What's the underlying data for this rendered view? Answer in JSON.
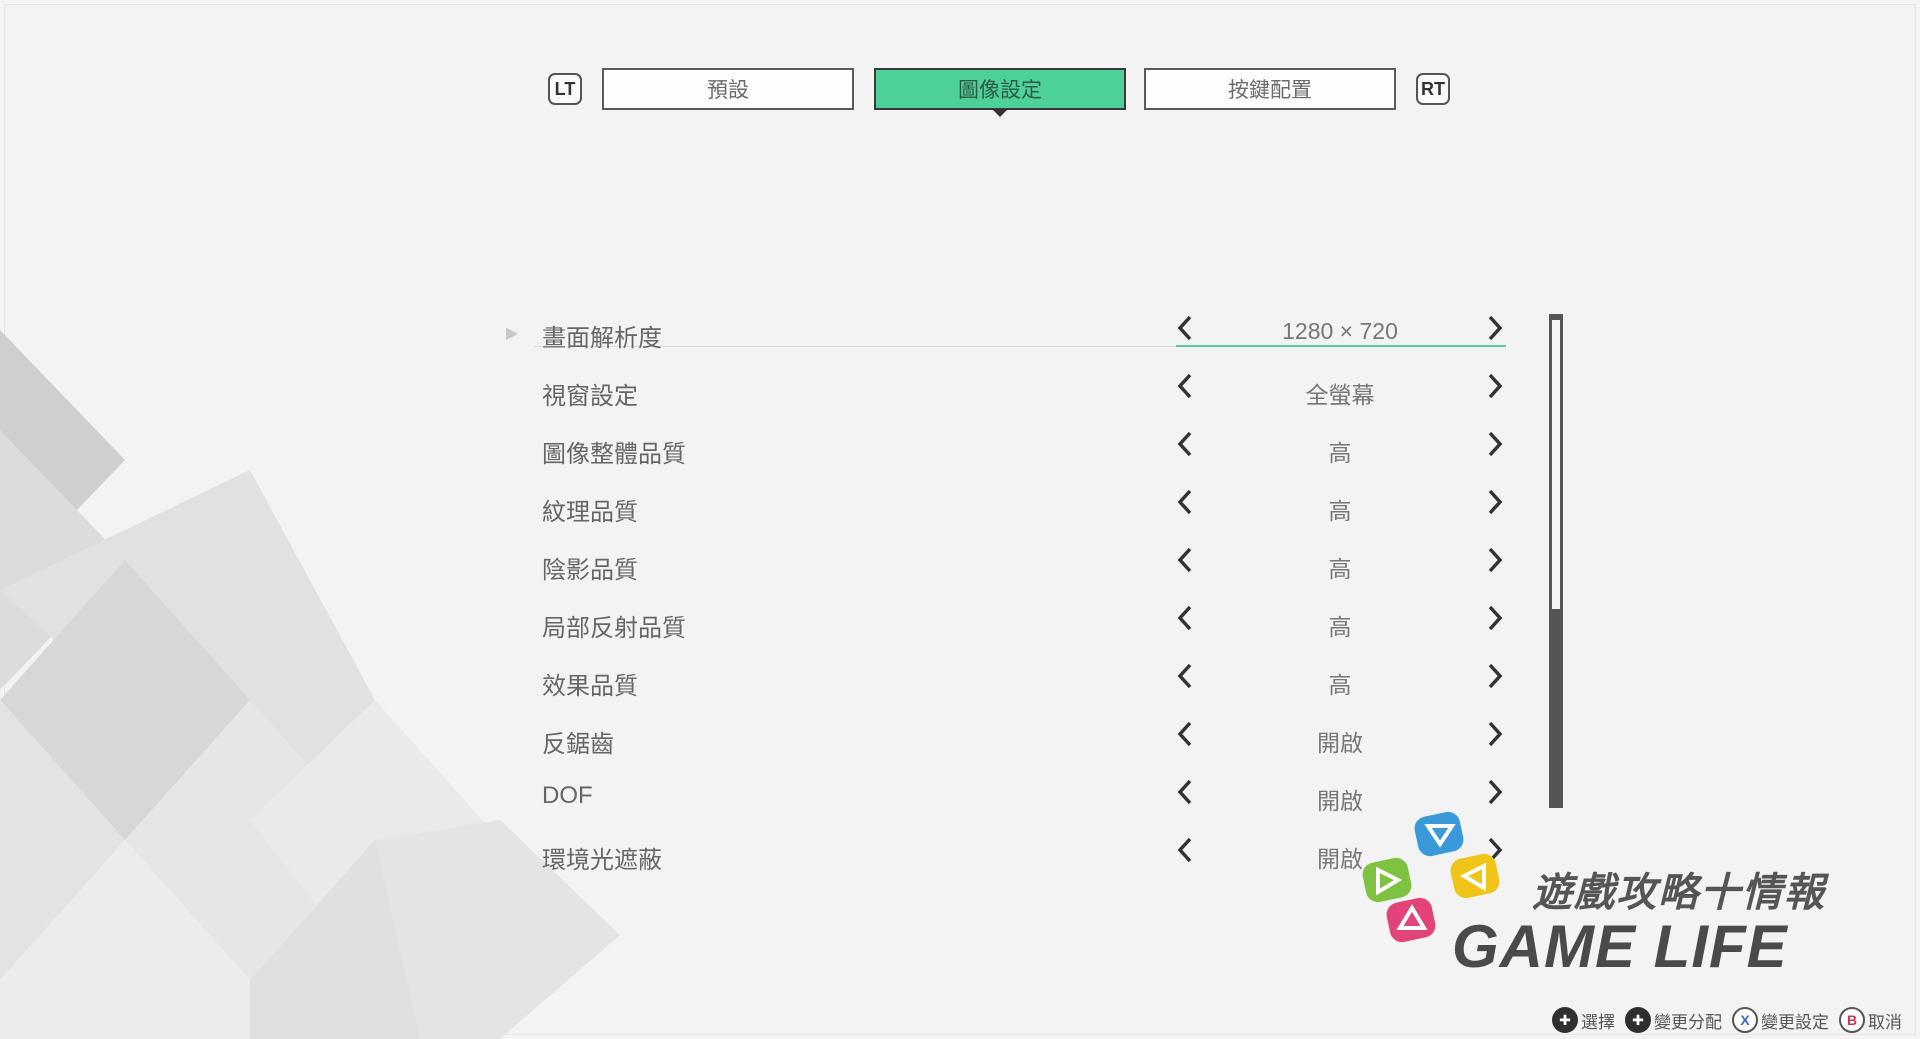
{
  "tabs": {
    "left_shoulder": "LT",
    "right_shoulder": "RT",
    "items": [
      {
        "label": "預設",
        "active": false
      },
      {
        "label": "圖像設定",
        "active": true
      },
      {
        "label": "按鍵配置",
        "active": false
      }
    ]
  },
  "settings": [
    {
      "label": "畫面解析度",
      "value": "1280 × 720",
      "selected": true
    },
    {
      "label": "視窗設定",
      "value": "全螢幕"
    },
    {
      "label": "圖像整體品質",
      "value": "高"
    },
    {
      "label": "紋理品質",
      "value": "高"
    },
    {
      "label": "陰影品質",
      "value": "高"
    },
    {
      "label": "局部反射品質",
      "value": "高"
    },
    {
      "label": "效果品質",
      "value": "高"
    },
    {
      "label": "反鋸齒",
      "value": "開啟"
    },
    {
      "label": "DOF",
      "value": "開啟"
    },
    {
      "label": "環境光遮蔽",
      "value": "開啟"
    }
  ],
  "scroll": {
    "visible_fraction": 0.6
  },
  "watermark": {
    "zh": "遊戲攻略十情報",
    "en": "GAME LIFE"
  },
  "hints": [
    {
      "icon": "dpad-icon",
      "glyph": "✚",
      "label": "選擇"
    },
    {
      "icon": "dpad-icon",
      "glyph": "✚",
      "label": "變更分配"
    },
    {
      "icon": "x-button-icon",
      "glyph": "X",
      "label": "變更設定"
    },
    {
      "icon": "b-button-icon",
      "glyph": "B",
      "label": "取消"
    }
  ],
  "colors": {
    "accent": "#4ed199",
    "background": "#f3f3f3",
    "logo_blue": "#3a9ad9",
    "logo_green": "#7fc242",
    "logo_yellow": "#f0c419",
    "logo_pink": "#e2447a"
  }
}
